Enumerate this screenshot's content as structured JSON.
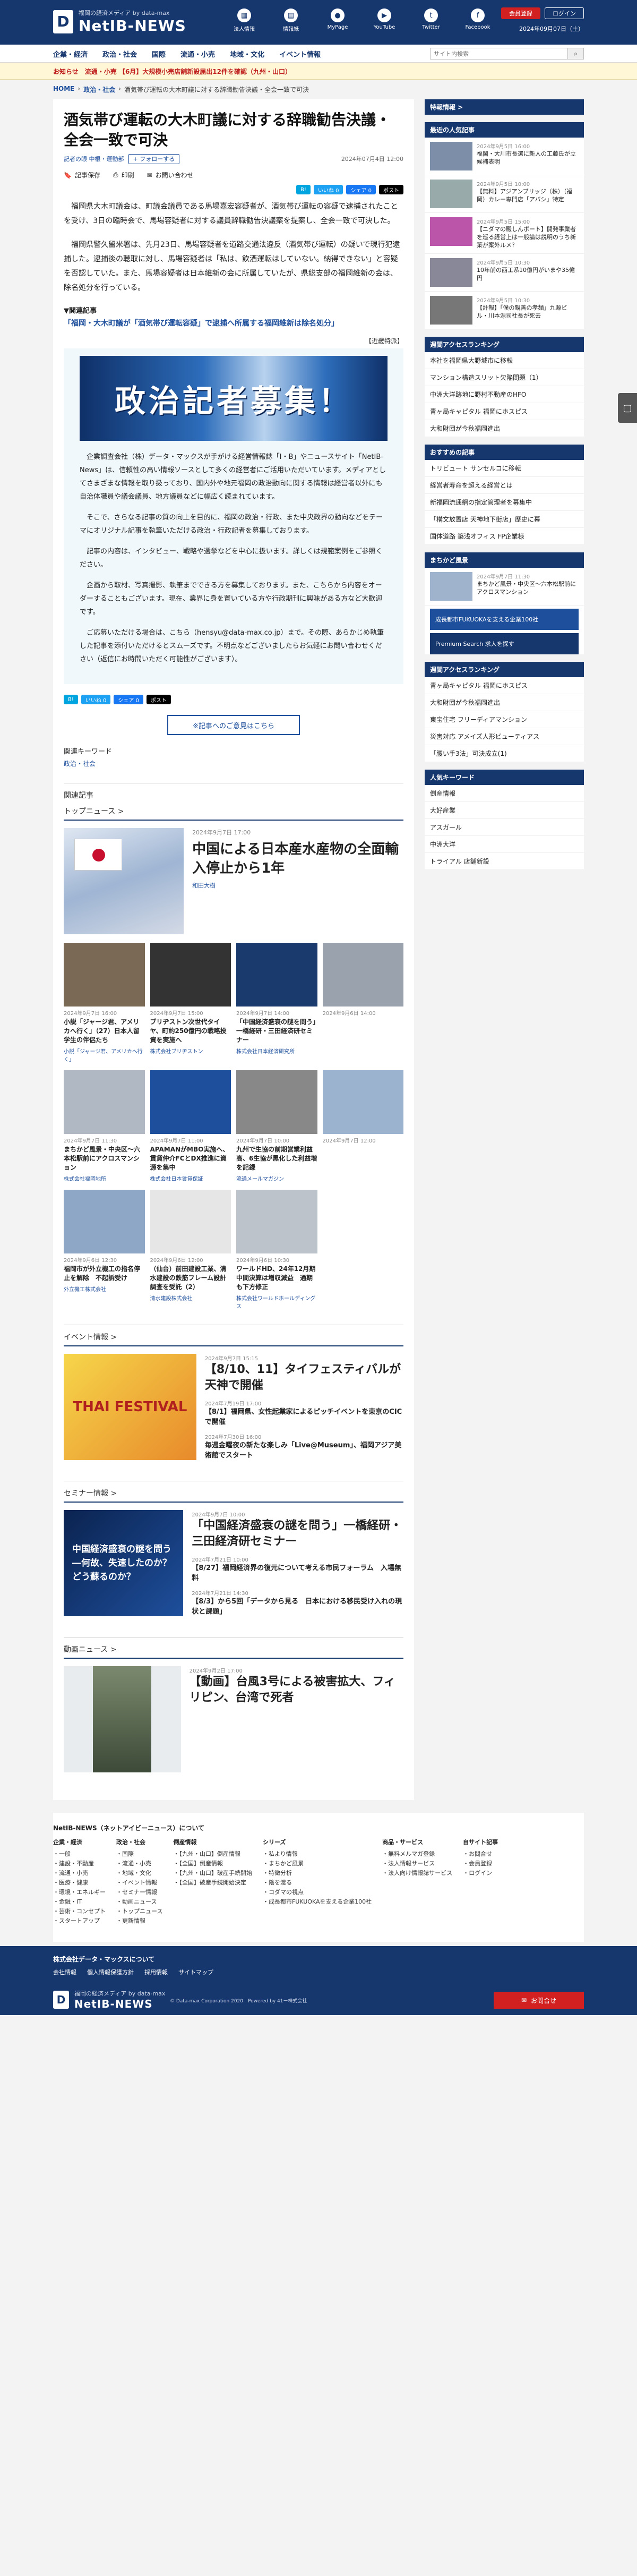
{
  "header": {
    "tagline": "福岡の経済メディア by data-max",
    "logo": "NetIB-NEWS",
    "icons": [
      {
        "label": "法人情報",
        "icon": "building-icon"
      },
      {
        "label": "情報紙",
        "icon": "newspaper-icon"
      },
      {
        "label": "MyPage",
        "icon": "user-icon"
      },
      {
        "label": "YouTube",
        "icon": "youtube-icon"
      },
      {
        "label": "Twitter",
        "icon": "twitter-icon"
      },
      {
        "label": "Facebook",
        "icon": "facebook-icon"
      }
    ],
    "register_btn": "会員登録",
    "login_btn": "ログイン",
    "date": "2024年09月07日（土）"
  },
  "nav": {
    "items": [
      "企業・経済",
      "政治・社会",
      "国際",
      "流通・小売",
      "地域・文化",
      "イベント情報"
    ],
    "search_placeholder": "サイト内検索"
  },
  "notice": {
    "label": "お知らせ",
    "text": "流通・小売 【6月】大規模小売店舗新設届出12件を確認（九州・山口）"
  },
  "breadcrumb": [
    "HOME",
    "政治・社会",
    "酒気帯び運転の大木町議に対する辞職勧告決議・全会一致で可決"
  ],
  "article": {
    "title": "酒気帯び運転の大木町議に対する辞職勧告決議・全会一致で可決",
    "writer": "記者の眼 中根・運動部",
    "follow": "+ フォローする",
    "date": "2024年07月4日 12:00",
    "tools": [
      "記事保存",
      "印刷",
      "お問い合わせ"
    ],
    "share": [
      "いいね 0",
      "シェア 0",
      "ポスト"
    ],
    "paragraphs": [
      "福岡県大木町議会は、町議会議員である馬場嘉宏容疑者が、酒気帯び運転の容疑で逮捕されたことを受け、3日の臨時会で、馬場容疑者に対する議員辞職勧告決議案を提案し、全会一致で可決した。",
      "福岡県警久留米署は、先月23日、馬場容疑者を道路交通法違反（酒気帯び運転）の疑いで現行犯逮捕した。逮捕後の聴取に対し、馬場容疑者は「私は、飲酒運転はしていない。納得できない」と容疑を否認していた。また、馬場容疑者は日本維新の会に所属していたが、県総支部の福岡維新の会は、除名処分を行っている。"
    ],
    "related_label": "▼関連記事",
    "related_link": "「福岡・大木町議が「酒気帯び運転容疑」で逮捕へ所属する福岡維新は除名処分」",
    "ad_label": "【近畿特派】",
    "ad_banner": "政治記者募集！",
    "ad_paragraphs": [
      "企業調査会社（株）データ・マックスが手がける経営情報誌「I・B」やニュースサイト「NetIB-News」は、信頼性の高い情報ソースとして多くの経営者にご活用いただいています。メディアとしてさまざまな情報を取り扱っており、国内外や地元福岡の政治動向に関する情報は経営者以外にも自治体職員や議会議員、地方議員などに幅広く読まれています。",
      "そこで、さらなる記事の質の向上を目的に、福岡の政治・行政、また中央政界の動向などをテーマにオリジナル記事を執筆いただける政治・行政記者を募集しております。",
      "記事の内容は、インタビュー、戦略や選挙などを中心に扱います。詳しくは規範案例をご参照ください。",
      "企画から取材、写真撮影、執筆までできる方を募集しております。また、こちらから内容をオーダーすることもございます。現在、業界に身を置いている方や行政期刊に興味がある方など大歓迎です。",
      "ご応募いただける場合は、こちら（hensyu@data-max.co.jp）まで。その際、あらかじめ執筆した記事を添付いただけるとスムーズです。不明点などございましたらお気軽にお問い合わせください（返信にお時間いただく可能性がございます）。"
    ],
    "contact_btn": "※記事へのご意見はこちら",
    "keyword_label": "関連キーワード",
    "keyword": "政治・社会",
    "related_articles_label": "関連記事"
  },
  "top_news": {
    "label": "トップニュース >",
    "feature": {
      "date": "2024年9月7日 17:00",
      "title": "中国による日本産水産物の全面輸入停止から1年",
      "writer": "和田大樹"
    },
    "cards": [
      {
        "date": "2024年9月7日 16:00",
        "title": "小説「ジャージ君、アメリカへ行く」（27）日本人留学生の伴侶たち",
        "writer": "小説「ジャージ君、アメリカへ行く」",
        "color": "#7a6a55"
      },
      {
        "date": "2024年9月7日 15:00",
        "title": "ブリヂストン次世代タイヤ、町約250億円の戦略投資を実施へ",
        "writer": "株式会社ブリヂストン",
        "color": "#333"
      },
      {
        "date": "2024年9月7日 14:00",
        "title": "「中国経済盛衰の謎を問う」一橋経研・三田経済研セミナー",
        "writer": "株式会社日本経済研究所",
        "color": "#1a3a6e"
      },
      {
        "date": "2024年9月6日 14:00",
        "title": "",
        "writer": "",
        "color": "#9aa3ad"
      },
      {
        "date": "2024年9月7日 11:30",
        "title": "まちかど風景・中央区～六本松駅前にアクロスマンション",
        "writer": "株式会社福岡地所",
        "color": "#b0b8c4"
      },
      {
        "date": "2024年9月7日 11:00",
        "title": "APAMANがMBO実施へ、賃貸仲介FCとDX推進に資源を集中",
        "writer": "株式会社日本賃貸保証",
        "color": "#1e4f9c"
      },
      {
        "date": "2024年9月7日 10:00",
        "title": "九州で生協の前期営業利益高、6生協が黒化した利益増を記録",
        "writer": "流通メールマガジン",
        "color": "#888"
      },
      {
        "date": "2024年9月7日 12:00",
        "title": "",
        "writer": "",
        "color": "#9cb3cf"
      },
      {
        "date": "2024年9月6日 12:30",
        "title": "福岡市が外立機工の指名停止を解除　不起訴受け",
        "writer": "外立機工株式会社",
        "color": "#8fa7c6"
      },
      {
        "date": "2024年9月6日 12:00",
        "title": "（仙台）前田建設工業、清水建設の鉄筋フレーム設計調査を受託（2）",
        "writer": "清水建設株式会社",
        "color": "#e6e6e6"
      },
      {
        "date": "2024年9月6日 10:30",
        "title": "ワールドHD、24年12月期中間決算は増収減益　通期も下方修正",
        "writer": "株式会社ワールドホールディングス",
        "color": "#bcc3ca"
      },
      {
        "date": "",
        "title": "",
        "writer": "",
        "color": "#ffffff"
      }
    ]
  },
  "events": {
    "label": "イベント情報 >",
    "image_text": "THAI FESTIVAL",
    "items": [
      {
        "date": "2024年9月7日 15:15",
        "title": "【8/10、11】タイフェスティバルが天神で開催",
        "big": true
      },
      {
        "date": "2024年7月19日 17:00",
        "title": "【8/1】福岡県、女性起業家によるピッチイベントを東京のCICで開催",
        "big": false
      },
      {
        "date": "2024年7月30日 16:00",
        "title": "毎週金曜夜の新たな楽しみ「Live@Museum」、福岡アジア美術館でスタート",
        "big": false
      }
    ]
  },
  "seminar": {
    "label": "セミナー情報 >",
    "image_text": "中国経済盛衰の謎を問う―何故、失速したのか？どう蘇るのか？",
    "items": [
      {
        "date": "2024年9月7日 10:00",
        "title": "「中国経済盛衰の謎を問う」一橋経研・三田経済研セミナー",
        "big": true
      },
      {
        "date": "2024年7月21日 10:00",
        "title": "【8/27】福岡経済界の復元について考える市民フォーラム　入場無料",
        "big": false
      },
      {
        "date": "2024年7月21日 14:30",
        "title": "【8/3】から5回「データから見る　日本における移民受け入れの現状と課題」",
        "big": false
      }
    ]
  },
  "video": {
    "label": "動画ニュース >",
    "date": "2024年9月2日 17:00",
    "title": "【動画】台風3号による被害拡大、フィリピン、台湾で死者"
  },
  "sidebar": {
    "box1": "特報情報 >",
    "popular_label": "最近の人気記事",
    "popular": [
      {
        "date": "2024年9月5日 16:00",
        "title": "福岡・大川市長選に新人の工藤氏が立候補表明",
        "color": "#7d8fa8"
      },
      {
        "date": "2024年9月5日 10:00",
        "title": "【無料】アジアンブリッジ（株）（福岡）カレー専門店「アバシ」特定",
        "color": "#9aa"
      },
      {
        "date": "2024年9月5日 15:00",
        "title": "【ニダマの殿しんポート】開発事業者を巡る経営上は一般論は説明のうち新築が案外ルメ？",
        "color": "#b5a"
      },
      {
        "date": "2024年9月5日 10:30",
        "title": "10年前の西工系10億円がいまや35億円",
        "color": "#889"
      },
      {
        "date": "2024年9月5日 10:30",
        "title": "【計報】「僕の親善の孝麺」九源ビル・川本源司社長が死去",
        "color": "#777"
      }
    ],
    "access_label": "週間アクセスランキング",
    "access": [
      "本社を福岡県大野城市に移転",
      "マンション構造スリット欠陥問題（1）",
      "中洲大洋跡地に野村不動産のHFO",
      "青ヶ局キャピタル 福岡にホスピス",
      "大和財団が今秋福岡進出"
    ],
    "recommend_label": "おすすめの記事",
    "recommend": [
      "トリビュート サンセルコに移転",
      "経営者寿命を超える経営とは",
      "新福岡流通網の指定管理者を募集中",
      "「構文放置店 天神地下街店」歴史に幕",
      "国体道路 築浅オフィス FP企業様"
    ],
    "machikado_label": "まちかど風景",
    "machikado": {
      "date": "2024年9月7日 11:30",
      "title": "まちかど風景・中央区～六本松駅前にアクロスマンション"
    },
    "ad1": "成長都市FUKUOKAを支える企業100社",
    "ad2": "Premium Search 求人を探す",
    "weekly_label": "週間アクセスランキング",
    "weekly": [
      "青ヶ局キャピタル 福岡にホスピス",
      "大和財団が今秋福岡進出",
      "東宝住宅 フリーディアマンション",
      "災害対応 アメイズ人形ビューティアス",
      "「腰い手3法」可決成立(1)"
    ],
    "popkw_label": "人気キーワード",
    "popkw": [
      "倒産情報",
      "大好産業",
      "アスガール",
      "中洲大洋",
      "トライアル 店舗新設"
    ]
  },
  "footer": {
    "title": "NetIB-NEWS（ネットアイビーニュース）について",
    "cols": [
      {
        "h": "企業・経済",
        "l": [
          "一般",
          "建設・不動産",
          "流通・小売",
          "医療・健康",
          "環境・エネルギー",
          "金融・IT",
          "芸術・コンセプト",
          "スタートアップ"
        ]
      },
      {
        "h": "政治・社会",
        "l": [
          "国際",
          "流通・小売",
          "地域・文化",
          "イベント情報",
          "セミナー情報",
          "動画ニュース",
          "トップニュース",
          "更新情報"
        ]
      },
      {
        "h": "倒産情報",
        "l": [
          "【九州・山口】倒産情報",
          "【全国】倒産情報",
          "【九州・山口】破産手続開始",
          "【全国】破産手続開始決定"
        ]
      },
      {
        "h": "シリーズ",
        "l": [
          "私より情報",
          "まちかど風景",
          "特徴分析",
          "陰を渡る",
          "コダマの視点",
          "成長都市FUKUOKAを支える企業100社"
        ]
      },
      {
        "h": "商品・サービス",
        "l": [
          "無料メルマガ登録",
          "法人情報サービス",
          "法人向け情報誌サービス"
        ]
      },
      {
        "h": "自サイト記事",
        "l": [
          "お問合せ",
          "会員登録",
          "ログイン"
        ]
      }
    ],
    "corp": "株式会社データ・マックスについて",
    "links": [
      "会社情報",
      "個人情報保護方針",
      "採用情報",
      "サイトマップ"
    ],
    "copyright": "© Data-max Corporation 2020　Powered by 41ー株式会社",
    "inquiry": "お問合せ"
  }
}
